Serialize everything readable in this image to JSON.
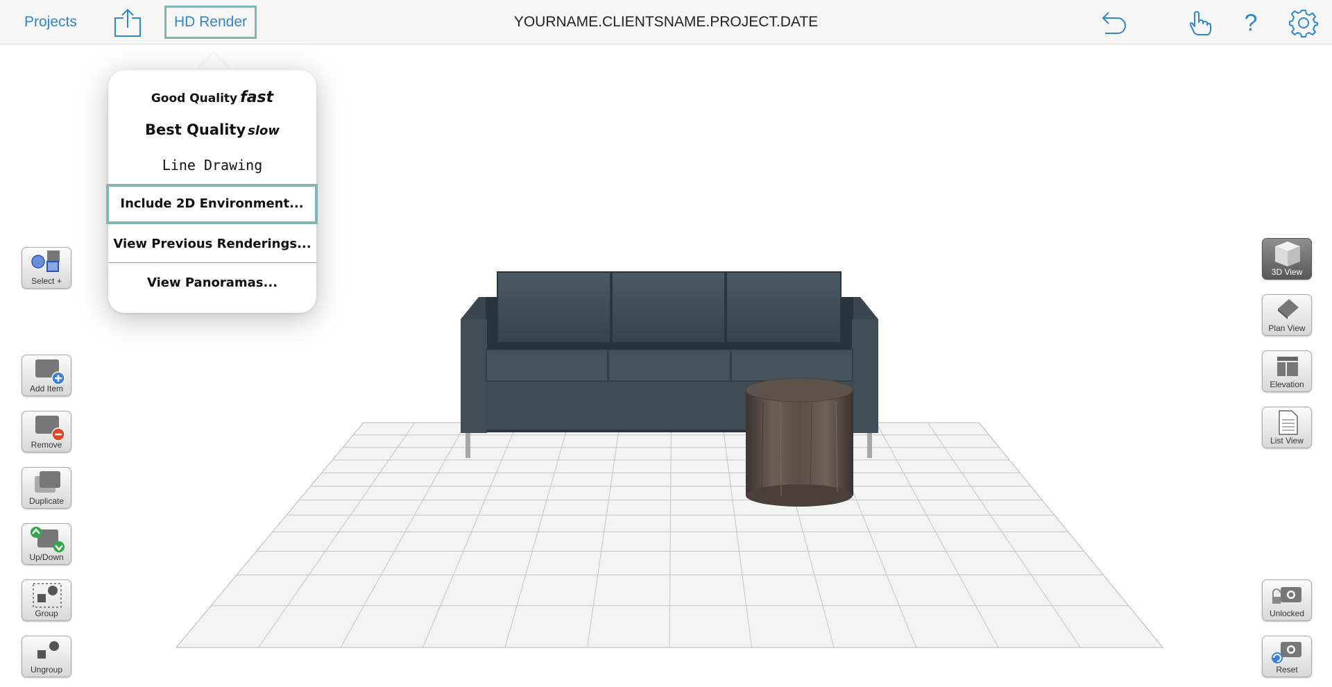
{
  "topbar": {
    "projects_label": "Projects",
    "hd_render_label": "HD Render",
    "document_title": "YOURNAME.CLIENTSNAME.PROJECT.DATE",
    "help_label": "?",
    "icons": [
      "share-icon",
      "undo-icon",
      "touch-hand-icon",
      "help-icon",
      "gear-icon"
    ]
  },
  "render_menu": {
    "good_quality": {
      "label": "Good Quality",
      "speed": "fast"
    },
    "best_quality": {
      "label": "Best Quality",
      "speed": "slow"
    },
    "line_drawing": "Line Drawing",
    "include_2d": "Include 2D Environment...",
    "view_previous": "View Previous Renderings...",
    "view_panoramas": "View Panoramas..."
  },
  "left_tools": {
    "select": "Select +",
    "add_item": "Add Item",
    "remove": "Remove",
    "duplicate": "Duplicate",
    "up_down": "Up/Down",
    "group": "Group",
    "ungroup": "Ungroup"
  },
  "right_tools": {
    "view_3d": "3D View",
    "plan_view": "Plan View",
    "elevation": "Elevation",
    "list_view": "List View",
    "unlocked": "Unlocked",
    "reset": "Reset",
    "active_view": "3D View"
  },
  "colors": {
    "accent": "#2f86cf",
    "highlight_border": "#7fb8b0",
    "sofa": "#3f4d57",
    "side_table": "#5b4f47"
  }
}
